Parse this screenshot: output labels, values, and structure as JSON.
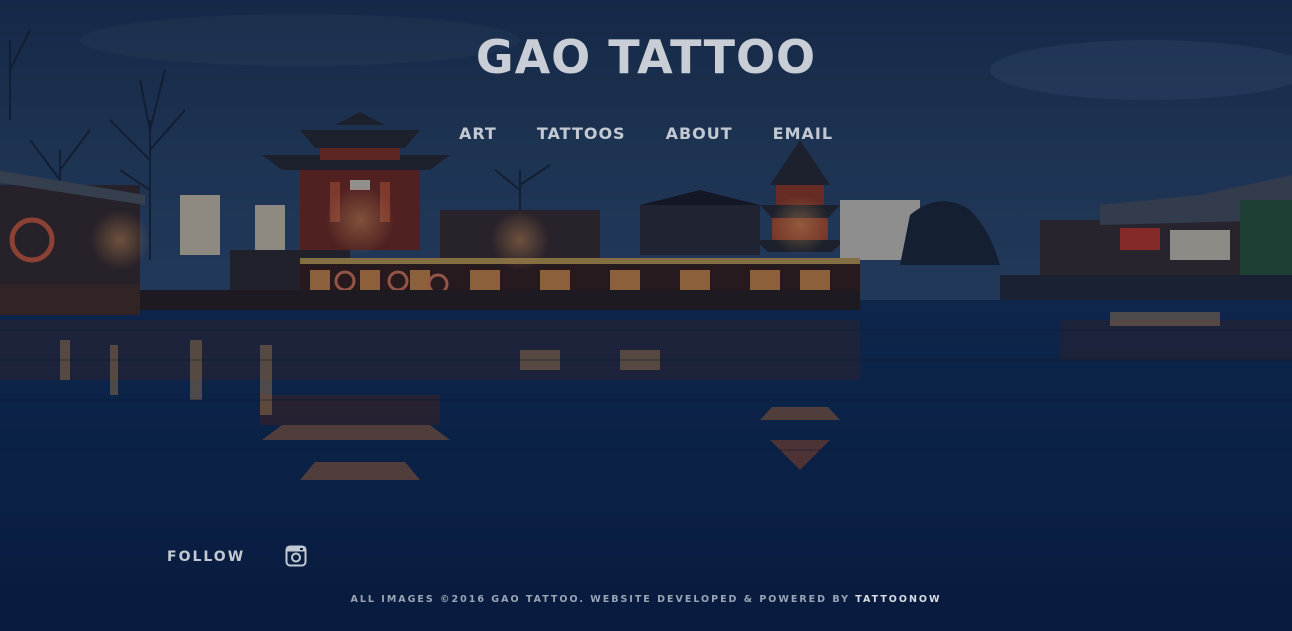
{
  "site": {
    "title": "GAO TATTOO"
  },
  "nav": {
    "items": [
      "ART",
      "TATTOOS",
      "ABOUT",
      "EMAIL"
    ]
  },
  "social": {
    "follow_label": "FOLLOW",
    "icon": "instagram-icon"
  },
  "footer": {
    "text": "ALL IMAGES ©2016 GAO TATTOO. WEBSITE DEVELOPED & POWERED BY",
    "link": "TATTOONOW"
  },
  "colors": {
    "background": "#0b1f3c",
    "text": "#c9ced6",
    "water": "#0d2a55",
    "lantern": "#c9402a"
  }
}
